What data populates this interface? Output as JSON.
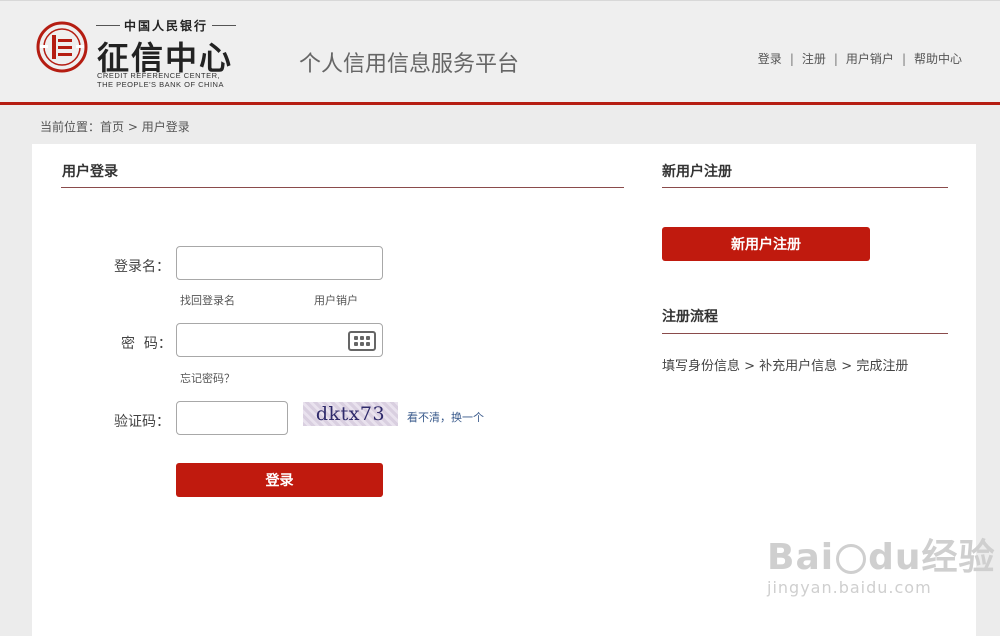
{
  "header": {
    "bank_name": "中国人民银行",
    "center_name": "征信中心",
    "en_line1": "CREDIT REFERENCE CENTER,",
    "en_line2": "THE PEOPLE'S BANK OF CHINA",
    "platform_title": "个人信用信息服务平台",
    "nav": {
      "login": "登录",
      "register": "注册",
      "cancel": "用户销户",
      "help": "帮助中心",
      "separator": "|"
    },
    "accent_color": "#b51d12"
  },
  "breadcrumb": {
    "prefix": "当前位置：",
    "home": "首页",
    "separator": " > ",
    "current": "用户登录"
  },
  "login": {
    "title": "用户登录",
    "username_label": "登录名：",
    "username_value": "",
    "find_username": "找回登录名",
    "cancel_account": "用户销户",
    "password_label": "密  码：",
    "password_value": "",
    "forgot_password": "忘记密码？",
    "captcha_label": "验证码：",
    "captcha_value": "",
    "captcha_text": "dktx73",
    "refresh_captcha": "看不清，换一个",
    "submit": "登录"
  },
  "register": {
    "title": "新用户注册",
    "button": "新用户注册",
    "flow_title": "注册流程",
    "flow_steps": "填写身份信息 > 补充用户信息 > 完成注册"
  },
  "watermark": {
    "line1_a": "Bai",
    "line1_b": "du",
    "line1_c": "经验",
    "line2": "jingyan.baidu.com"
  }
}
